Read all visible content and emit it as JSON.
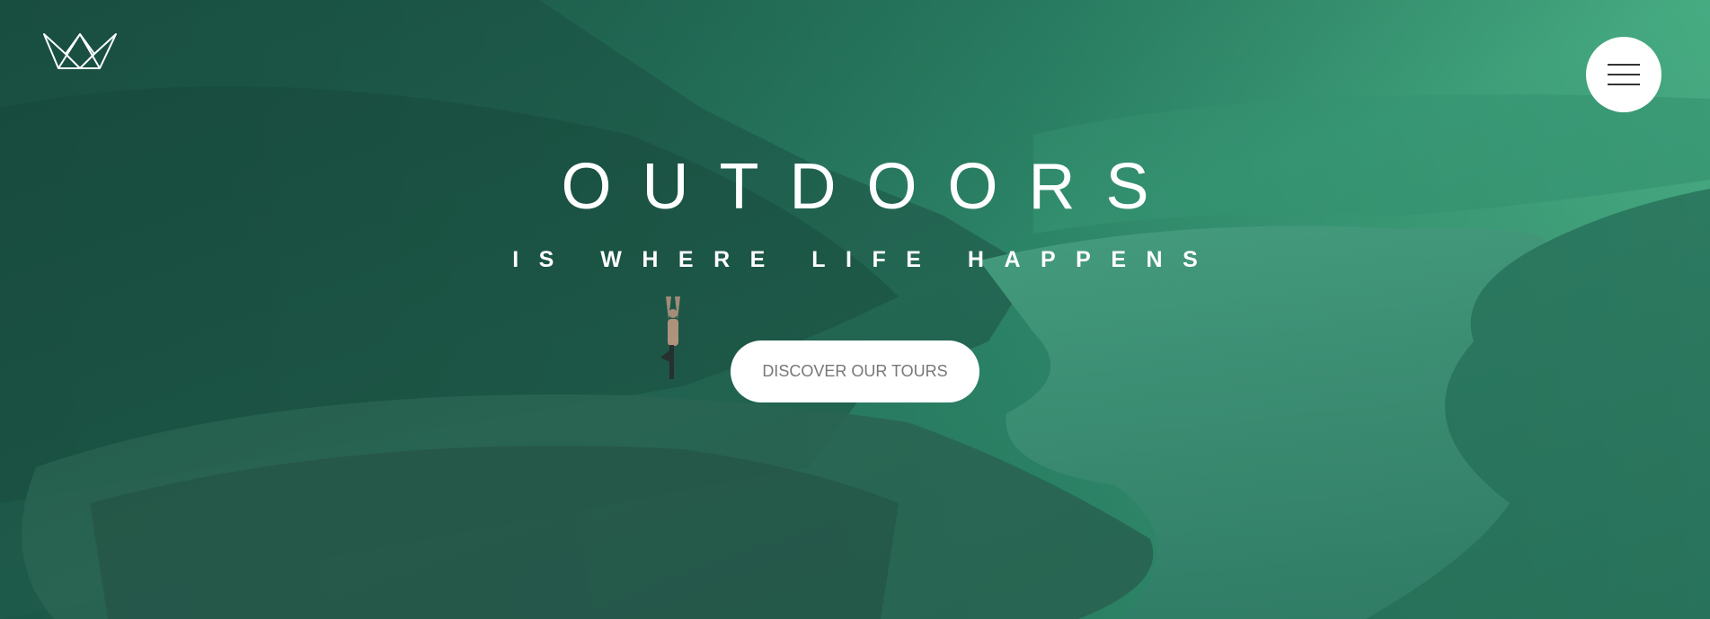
{
  "header": {
    "logo_icon": "crown-logo-icon",
    "menu_icon": "hamburger-menu-icon"
  },
  "hero": {
    "title": "OUTDOORS",
    "subtitle": "IS WHERE LIFE HAPPENS",
    "cta_label": "DISCOVER OUR TOURS"
  },
  "colors": {
    "overlay_dark": "#173f36",
    "overlay_light": "#4fbf8e",
    "button_bg": "#ffffff",
    "button_text": "#777777"
  }
}
